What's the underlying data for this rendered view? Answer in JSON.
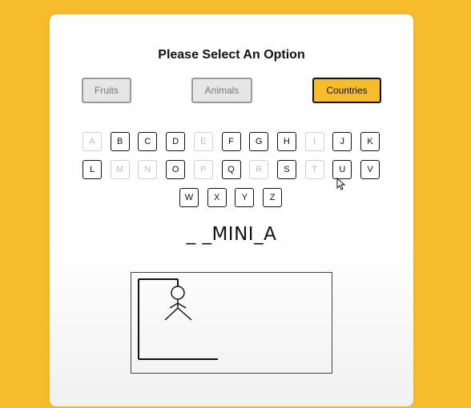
{
  "title": "Please Select An Option",
  "options": [
    {
      "label": "Fruits",
      "state": "disabled"
    },
    {
      "label": "Animals",
      "state": "disabled"
    },
    {
      "label": "Countries",
      "state": "active"
    }
  ],
  "keyboard": {
    "rows": [
      [
        {
          "letter": "A",
          "enabled": false
        },
        {
          "letter": "B",
          "enabled": true
        },
        {
          "letter": "C",
          "enabled": true
        },
        {
          "letter": "D",
          "enabled": true
        },
        {
          "letter": "E",
          "enabled": false
        },
        {
          "letter": "F",
          "enabled": true
        },
        {
          "letter": "G",
          "enabled": true
        },
        {
          "letter": "H",
          "enabled": true
        },
        {
          "letter": "I",
          "enabled": false
        },
        {
          "letter": "J",
          "enabled": true
        },
        {
          "letter": "K",
          "enabled": true
        }
      ],
      [
        {
          "letter": "L",
          "enabled": true
        },
        {
          "letter": "M",
          "enabled": false
        },
        {
          "letter": "N",
          "enabled": false
        },
        {
          "letter": "O",
          "enabled": true
        },
        {
          "letter": "P",
          "enabled": false
        },
        {
          "letter": "Q",
          "enabled": true
        },
        {
          "letter": "R",
          "enabled": false
        },
        {
          "letter": "S",
          "enabled": true
        },
        {
          "letter": "T",
          "enabled": false
        },
        {
          "letter": "U",
          "enabled": true
        },
        {
          "letter": "V",
          "enabled": true
        }
      ],
      [
        {
          "letter": "W",
          "enabled": true
        },
        {
          "letter": "X",
          "enabled": true
        },
        {
          "letter": "Y",
          "enabled": true
        },
        {
          "letter": "Z",
          "enabled": true
        }
      ]
    ]
  },
  "word_display": "_ _MINI_A",
  "hangman": {
    "parts_shown": [
      "head",
      "body",
      "left-arm",
      "right-arm",
      "left-leg",
      "right-leg"
    ]
  },
  "colors": {
    "background": "#f5bd2c",
    "active_option": "#f5bd2c",
    "card": "#ffffff"
  }
}
